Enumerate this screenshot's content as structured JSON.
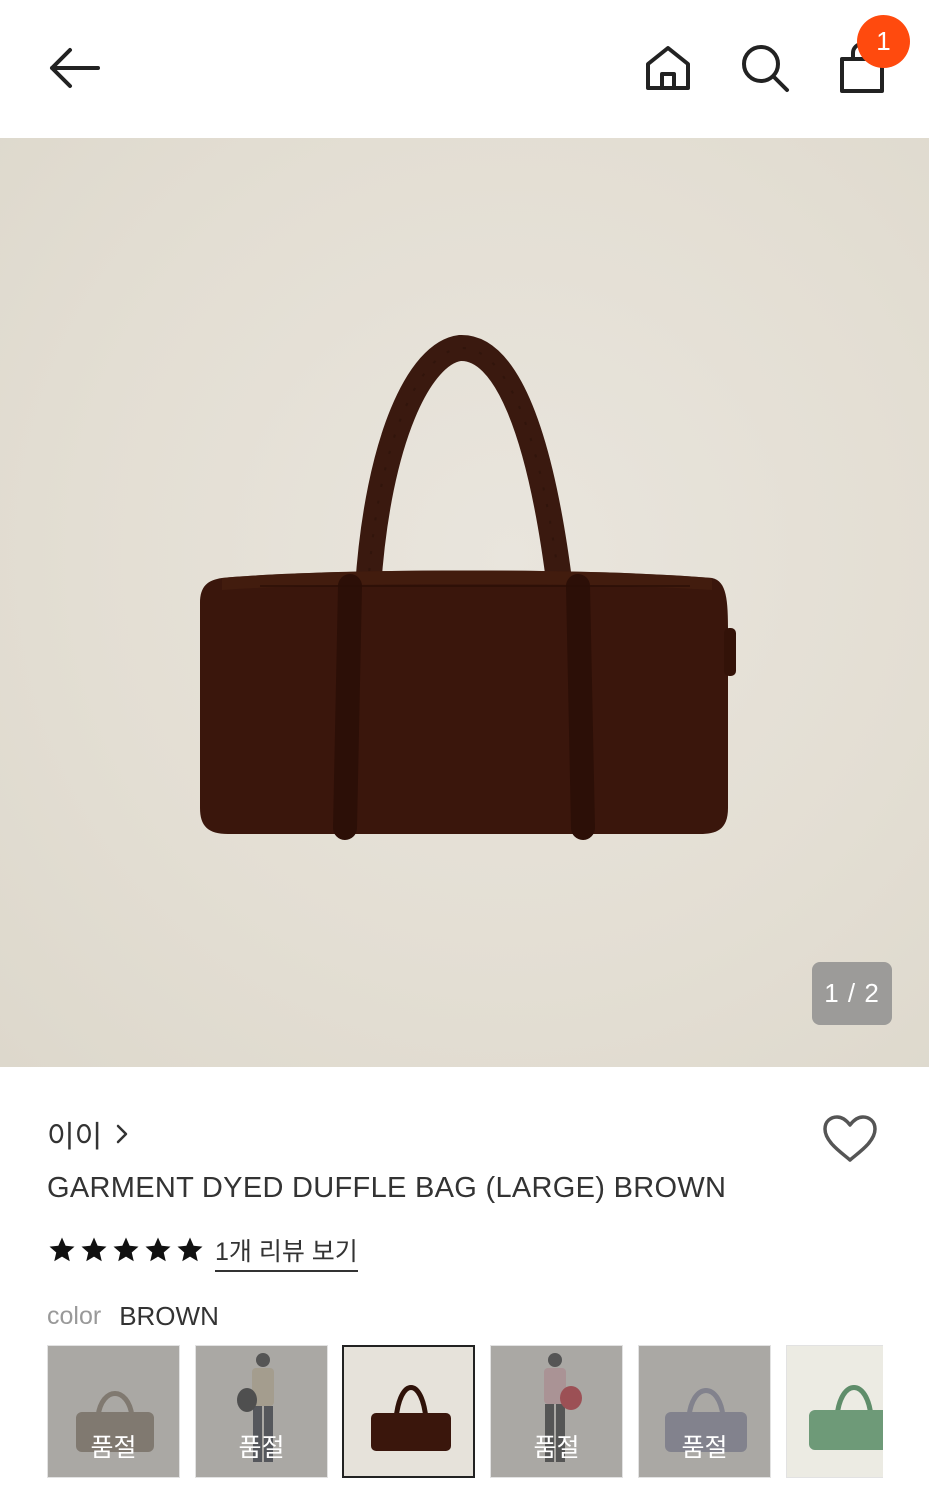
{
  "header": {
    "back_icon": "arrow-left-icon",
    "home_icon": "home-icon",
    "search_icon": "search-icon",
    "cart_icon": "shopping-bag-icon",
    "cart_count": "1",
    "badge_color": "#ff4a0e"
  },
  "gallery": {
    "indicator": "1 / 2",
    "current": 1,
    "total": 2
  },
  "product": {
    "brand": "이이",
    "brand_chevron_icon": "chevron-right-icon",
    "title": "GARMENT DYED DUFFLE BAG (LARGE) BROWN",
    "rating": 5,
    "rating_max": 5,
    "review_link": "1개 리뷰 보기",
    "wishlist_icon": "heart-outline-icon"
  },
  "colors": {
    "label": "color",
    "selected": "BROWN",
    "swatches": [
      {
        "status": "품절",
        "sold_out": true,
        "tone": "#8a7a66"
      },
      {
        "status": "품절",
        "sold_out": true,
        "tone": "#1e1e1e"
      },
      {
        "status": "",
        "sold_out": false,
        "tone": "#3a160c"
      },
      {
        "status": "품절",
        "sold_out": true,
        "tone": "#c8202c"
      },
      {
        "status": "품절",
        "sold_out": true,
        "tone": "#8e8ea6"
      },
      {
        "status": "",
        "sold_out": false,
        "tone": "#6e9a78"
      }
    ]
  }
}
